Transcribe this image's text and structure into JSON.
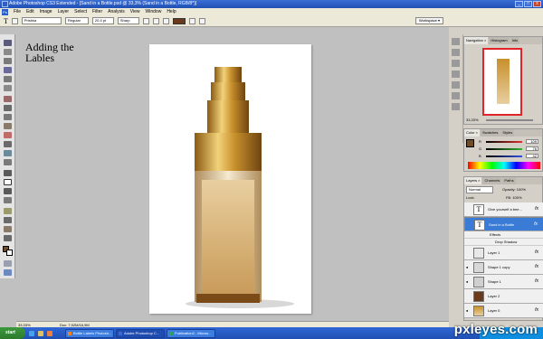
{
  "window": {
    "title": "Adobe Photoshop CS3 Extended - [Sand in a Bottle.psd @ 33,3% (Sand in a Bottle, RGB/8*)]",
    "controls": [
      "_",
      "□",
      "x"
    ]
  },
  "menu": [
    "File",
    "Edit",
    "Image",
    "Layer",
    "Select",
    "Filter",
    "Analysis",
    "View",
    "Window",
    "Help"
  ],
  "options": {
    "tool_icon": "T",
    "font_family": "Pristina",
    "font_style": "Regular",
    "font_size": "20,4 pt",
    "antialias": "Sharp",
    "text_color": "#6b3a1c",
    "workspace": "Workspace ▾"
  },
  "canvas_text": {
    "line1": "Adding the",
    "line2": "Lables"
  },
  "status": {
    "zoom": "33,33%",
    "doc": "Doc: 7,92M/16,9M"
  },
  "navigator": {
    "tabs": [
      "Navigation ×",
      "Histogram",
      "Info"
    ],
    "zoom": "33,33%"
  },
  "color_panel": {
    "tabs": [
      "Color ×",
      "Swatches",
      "Styles"
    ],
    "channels": [
      {
        "label": "R",
        "value": "109",
        "color": "#e03030"
      },
      {
        "label": "G",
        "value": "76",
        "color": "#30b030"
      },
      {
        "label": "B",
        "value": "42",
        "color": "#3050e0"
      }
    ],
    "foreground": "#6d4c2a"
  },
  "layers_panel": {
    "tabs": [
      "Layers ×",
      "Channels",
      "Paths"
    ],
    "blend_mode": "Normal",
    "opacity_label": "Opacity: 100%",
    "lock_label": "Lock:",
    "fill_label": "Fill: 100%",
    "layers": [
      {
        "name": "Give yourself a bee...",
        "type": "T",
        "fx": "fx",
        "selected": false
      },
      {
        "name": "Sand in a Bottle",
        "type": "T",
        "fx": "fx",
        "selected": true
      },
      {
        "name": "Layer 1",
        "type": "",
        "fx": "fx",
        "selected": false
      },
      {
        "name": "Shape 1 copy",
        "type": "",
        "fx": "fx",
        "selected": false
      },
      {
        "name": "Shape 1",
        "type": "",
        "fx": "fx",
        "selected": false
      },
      {
        "name": "Layer 2",
        "type": "",
        "fx": "",
        "selected": false
      },
      {
        "name": "Layer 0",
        "type": "",
        "fx": "fx",
        "selected": false
      }
    ],
    "effects_label": "Effects",
    "drop_shadow_label": "Drop Shadow"
  },
  "taskbar": {
    "start": "start",
    "tasks": [
      "Bottle Labels Photosh...",
      "Adobe Photoshop C...",
      "Publication2 - Micros..."
    ]
  },
  "watermark": "pxleyes.com"
}
